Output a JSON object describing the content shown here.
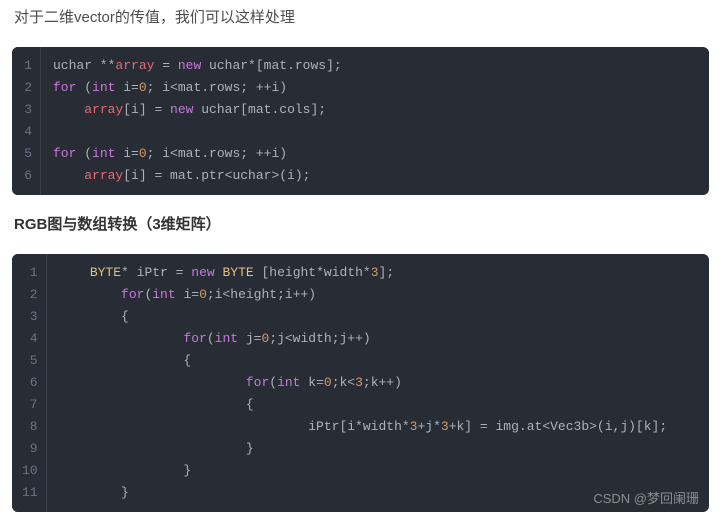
{
  "intro_text": "对于二维vector的传值，我们可以这样处理",
  "section_heading": "RGB图与数组转换（3维矩阵）",
  "watermark": "CSDN @梦回阑珊",
  "code1": {
    "tokens": [
      [
        [
          "pl",
          "uchar **"
        ],
        [
          "var",
          "array"
        ],
        [
          "pl",
          " = "
        ],
        [
          "kw",
          "new"
        ],
        [
          "pl",
          " uchar*[mat.rows];"
        ]
      ],
      [
        [
          "kw",
          "for"
        ],
        [
          "pl",
          " ("
        ],
        [
          "kw",
          "int"
        ],
        [
          "pl",
          " i="
        ],
        [
          "num",
          "0"
        ],
        [
          "pl",
          "; i<mat.rows; ++i)"
        ]
      ],
      [
        [
          "pl",
          "    "
        ],
        [
          "var",
          "array"
        ],
        [
          "pl",
          "[i] = "
        ],
        [
          "kw",
          "new"
        ],
        [
          "pl",
          " uchar[mat.cols];"
        ]
      ],
      [
        [
          "pl",
          ""
        ]
      ],
      [
        [
          "kw",
          "for"
        ],
        [
          "pl",
          " ("
        ],
        [
          "kw",
          "int"
        ],
        [
          "pl",
          " i="
        ],
        [
          "num",
          "0"
        ],
        [
          "pl",
          "; i<mat.rows; ++i)"
        ]
      ],
      [
        [
          "pl",
          "    "
        ],
        [
          "var",
          "array"
        ],
        [
          "pl",
          "[i] = mat.ptr<uchar>(i);"
        ]
      ]
    ]
  },
  "code2": {
    "tokens": [
      [
        [
          "pl",
          "    "
        ],
        [
          "cls",
          "BYTE"
        ],
        [
          "pl",
          "* iPtr = "
        ],
        [
          "kw",
          "new"
        ],
        [
          "pl",
          " "
        ],
        [
          "cls",
          "BYTE"
        ],
        [
          "pl",
          " [height*width*"
        ],
        [
          "num",
          "3"
        ],
        [
          "pl",
          "];"
        ]
      ],
      [
        [
          "pl",
          "        "
        ],
        [
          "kw",
          "for"
        ],
        [
          "pl",
          "("
        ],
        [
          "kw",
          "int"
        ],
        [
          "pl",
          " i="
        ],
        [
          "num",
          "0"
        ],
        [
          "pl",
          ";i<height;i++)"
        ]
      ],
      [
        [
          "pl",
          "        {"
        ]
      ],
      [
        [
          "pl",
          "                "
        ],
        [
          "kw",
          "for"
        ],
        [
          "pl",
          "("
        ],
        [
          "kw",
          "int"
        ],
        [
          "pl",
          " j="
        ],
        [
          "num",
          "0"
        ],
        [
          "pl",
          ";j<width;j++)"
        ]
      ],
      [
        [
          "pl",
          "                {"
        ]
      ],
      [
        [
          "pl",
          "                        "
        ],
        [
          "kw",
          "for"
        ],
        [
          "pl",
          "("
        ],
        [
          "kw",
          "int"
        ],
        [
          "pl",
          " k="
        ],
        [
          "num",
          "0"
        ],
        [
          "pl",
          ";k<"
        ],
        [
          "num",
          "3"
        ],
        [
          "pl",
          ";k++)"
        ]
      ],
      [
        [
          "pl",
          "                        {"
        ]
      ],
      [
        [
          "pl",
          "                                iPtr[i*width*"
        ],
        [
          "num",
          "3"
        ],
        [
          "pl",
          "+j*"
        ],
        [
          "num",
          "3"
        ],
        [
          "pl",
          "+k] = img.at<Vec3b>(i,j)[k];"
        ]
      ],
      [
        [
          "pl",
          "                        }"
        ]
      ],
      [
        [
          "pl",
          "                }"
        ]
      ],
      [
        [
          "pl",
          "        }"
        ]
      ]
    ]
  }
}
